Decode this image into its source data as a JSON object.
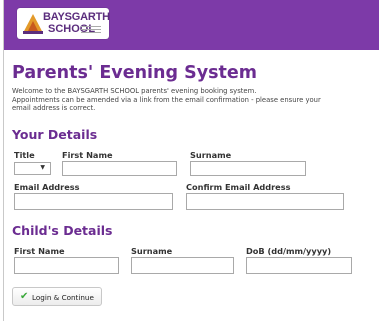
{
  "header": {
    "logo_line1": "BAYSGARTH",
    "logo_line2": "SCHOOL"
  },
  "page_title": "Parents' Evening System",
  "intro": {
    "line1": "Welcome to the BAYSGARTH SCHOOL parents' evening booking system.",
    "line2": "Appointments can be amended via a link from the email confirmation - please ensure your",
    "line3": "email address is correct."
  },
  "your_details": {
    "heading": "Your Details",
    "title_label": "Title",
    "title_value": "",
    "first_name_label": "First Name",
    "first_name_value": "",
    "surname_label": "Surname",
    "surname_value": "",
    "email_label": "Email Address",
    "email_value": "",
    "confirm_email_label": "Confirm Email Address",
    "confirm_email_value": ""
  },
  "childs_details": {
    "heading": "Child's Details",
    "first_name_label": "First Name",
    "first_name_value": "",
    "surname_label": "Surname",
    "surname_value": "",
    "dob_label": "DoB (dd/mm/yyyy)",
    "dob_value": ""
  },
  "login_button": {
    "icon": "checkmark-icon",
    "label": "Login & Continue"
  },
  "colors": {
    "header": "#7d3aa8",
    "heading": "#6b2c91"
  }
}
